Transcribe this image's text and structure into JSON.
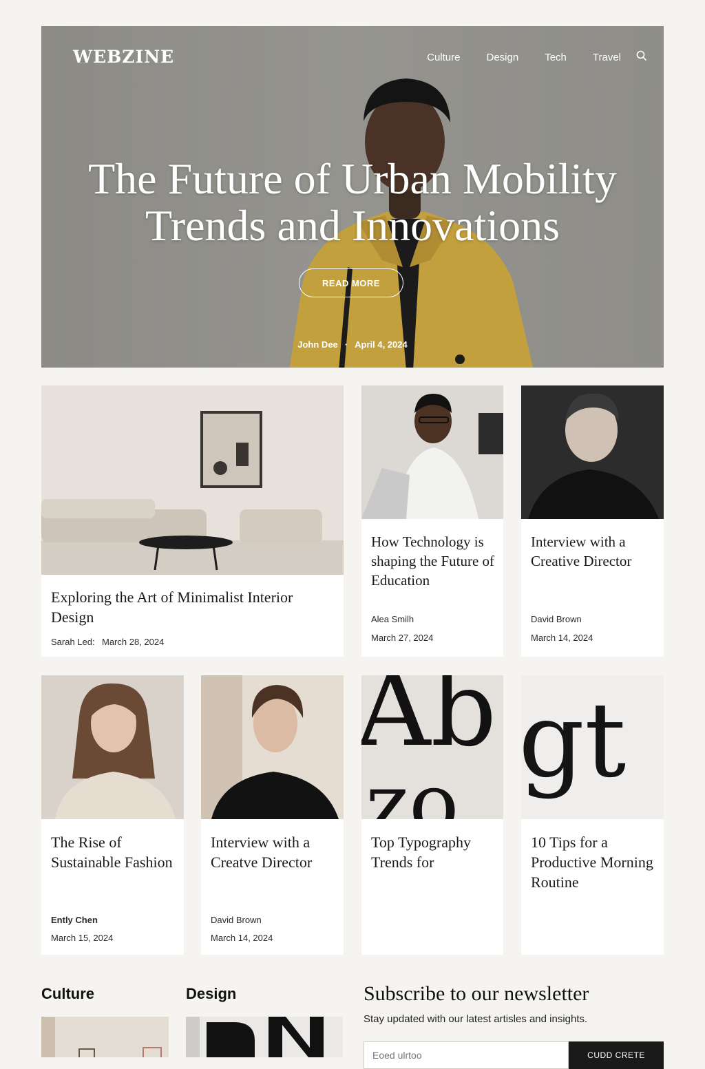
{
  "header": {
    "logo": "WEBZINE",
    "nav": [
      "Culture",
      "Design",
      "Tech",
      "Travel"
    ]
  },
  "hero": {
    "title_line1": "The Future of Urban Mobility",
    "title_line2": "Trends and Innovations",
    "cta": "READ MORE",
    "author": "John Dee",
    "separator": "·",
    "date": "April 4, 2024"
  },
  "featured": [
    {
      "title": "Exploring the Art of Minimalist Interior Design",
      "author": "Sarah Led:",
      "date": "March 28, 2024"
    },
    {
      "title": "How Technology is shaping the Future of Education",
      "author": "Alea Smilh",
      "date": "March 27, 2024"
    },
    {
      "title": "Interview with a Creative Director",
      "author": "David Brown",
      "date": "March 14, 2024"
    }
  ],
  "articles": [
    {
      "title": "The Rise of Sustainable Fashion",
      "author": "Ently Chen",
      "date": "March 15, 2024"
    },
    {
      "title": "Interview with a Creatve Director",
      "author": "David Brown",
      "date": "March 14, 2024"
    },
    {
      "title": "Top Typography Trends for",
      "author": "",
      "date": ""
    },
    {
      "title": "10 Tips for a Productive Morning Routine",
      "author": "",
      "date": ""
    }
  ],
  "typo_art": {
    "top": "Ab",
    "bottom": "zo",
    "right": "gt"
  },
  "sections": {
    "culture": "Culture",
    "design": "Design"
  },
  "newsletter": {
    "title": "Subscribe to our newsletter",
    "subtitle": "Stay updated with our latest artisles and insights.",
    "placeholder": "Eoed ulrtoo",
    "button": "CUDD CRETE"
  },
  "colors": {
    "hero_bg": "#8f8e89",
    "coat": "#c9a441",
    "page_bg": "#f6f4f0"
  }
}
